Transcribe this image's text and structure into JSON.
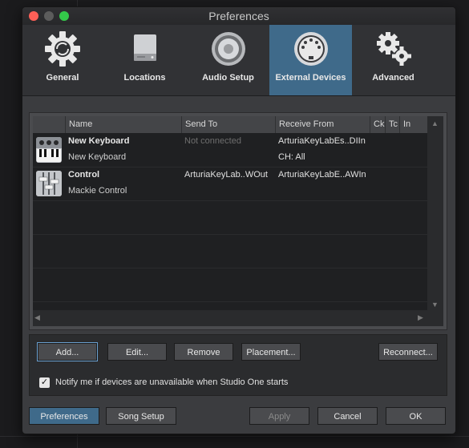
{
  "window": {
    "title": "Preferences"
  },
  "tabs": [
    {
      "label": "General",
      "icon": "gear-icon"
    },
    {
      "label": "Locations",
      "icon": "drive-icon"
    },
    {
      "label": "Audio Setup",
      "icon": "speaker-icon"
    },
    {
      "label": "External Devices",
      "icon": "midi-connector-icon",
      "active": true
    },
    {
      "label": "Advanced",
      "icon": "gears-icon"
    }
  ],
  "table": {
    "columns": [
      "Name",
      "Send To",
      "Receive From",
      "Ck",
      "Tc",
      "In"
    ],
    "rows": [
      {
        "icon": "keyboard-icon",
        "name": "New Keyboard",
        "subname": "New Keyboard",
        "send_to": "Not connected",
        "receive_from": "ArturiaKeyLabEs..DIIn",
        "receive_sub": "CH: All"
      },
      {
        "icon": "control-surface-icon",
        "name": "Control",
        "subname": "Mackie Control",
        "send_to": "ArturiaKeyLab..WOut",
        "receive_from": "ArturiaKeyLabE..AWIn",
        "receive_sub": ""
      }
    ]
  },
  "actions": {
    "add": "Add...",
    "edit": "Edit...",
    "remove": "Remove",
    "placement": "Placement...",
    "reconnect": "Reconnect..."
  },
  "notify": {
    "label": "Notify me if devices are unavailable when Studio One starts",
    "checked": true
  },
  "footer": {
    "preferences": "Preferences",
    "song_setup": "Song Setup",
    "apply": "Apply",
    "cancel": "Cancel",
    "ok": "OK"
  },
  "colors": {
    "accent": "#3f6a8a",
    "window_bg": "#3b3c3f",
    "close": "#fc5f57",
    "minimize": "#5c5c5c",
    "zoom": "#34c84a"
  }
}
